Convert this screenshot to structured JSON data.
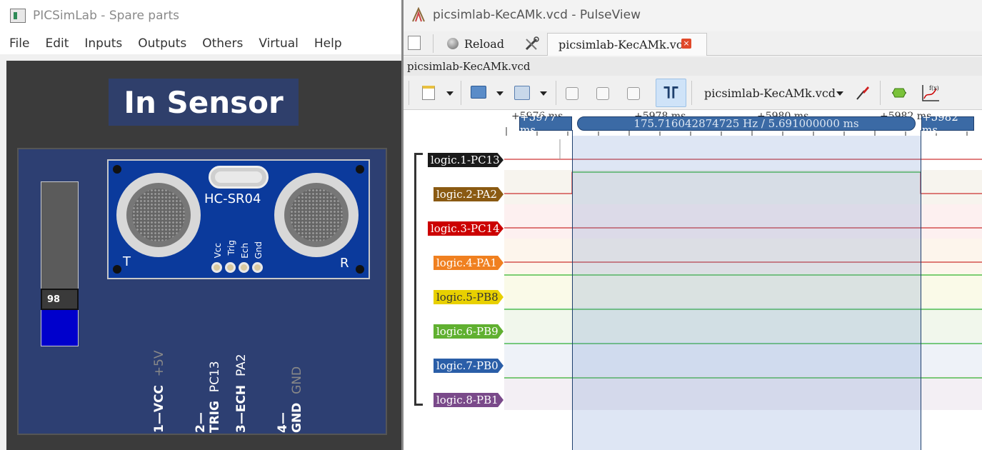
{
  "left_window": {
    "title": "PICSimLab - Spare parts",
    "menu": [
      "File",
      "Edit",
      "Inputs",
      "Outputs",
      "Others",
      "Virtual",
      "Help"
    ],
    "sensor_title": "In Sensor",
    "module_label": "HC-SR04",
    "pins": [
      "Vcc",
      "Trig",
      "Ech",
      "Gnd"
    ],
    "transmitter_label": "T",
    "receiver_label": "R",
    "slider_value": "98",
    "slider_level_fraction": 0.25,
    "connections": [
      {
        "num": "1",
        "name": "VCC",
        "signal": "+5V",
        "dim": true
      },
      {
        "num": "2",
        "name": "TRIG",
        "signal": "PC13",
        "dim": false
      },
      {
        "num": "3",
        "name": "ECH",
        "signal": "PA2",
        "dim": false
      },
      {
        "num": "4",
        "name": "GND",
        "signal": "GND",
        "dim": true
      }
    ]
  },
  "right_window": {
    "title": "picsimlab-KecAMk.vcd - PulseView",
    "reload_label": "Reload",
    "tab_label": "picsimlab-KecAMk.vcd",
    "tab_close": "×",
    "session_title": "picsimlab-KecAMk.vcd",
    "device_label": "picsimlab-KecAMk.vcd",
    "ruler": {
      "ticks": [
        "+5976 ms",
        "+5978 ms",
        "+5980 ms",
        "+5982 ms"
      ],
      "cursor_left": "+5977 ms",
      "cursor_right": "+5982 ms",
      "cursor_span": "175.716042874725 Hz / 5.691000000 ms"
    },
    "signals": [
      {
        "label": "logic.1-PC13",
        "color": "#1a1a1a",
        "band": "#ffffff"
      },
      {
        "label": "logic.2-PA2",
        "color": "#8a5a12",
        "band": "#f7f4ee"
      },
      {
        "label": "logic.3-PC14",
        "color": "#cc0000",
        "band": "#fdf0f0"
      },
      {
        "label": "logic.4-PA1",
        "color": "#f08020",
        "band": "#fdf5ec"
      },
      {
        "label": "logic.5-PB8",
        "color": "#e8d000",
        "band": "#fafae8"
      },
      {
        "label": "logic.6-PB9",
        "color": "#60b030",
        "band": "#f1f7ec"
      },
      {
        "label": "logic.7-PB0",
        "color": "#2a5ea8",
        "band": "#eef2f8"
      },
      {
        "label": "logic.8-PB1",
        "color": "#7a4a8a",
        "band": "#f3eff4"
      }
    ]
  }
}
